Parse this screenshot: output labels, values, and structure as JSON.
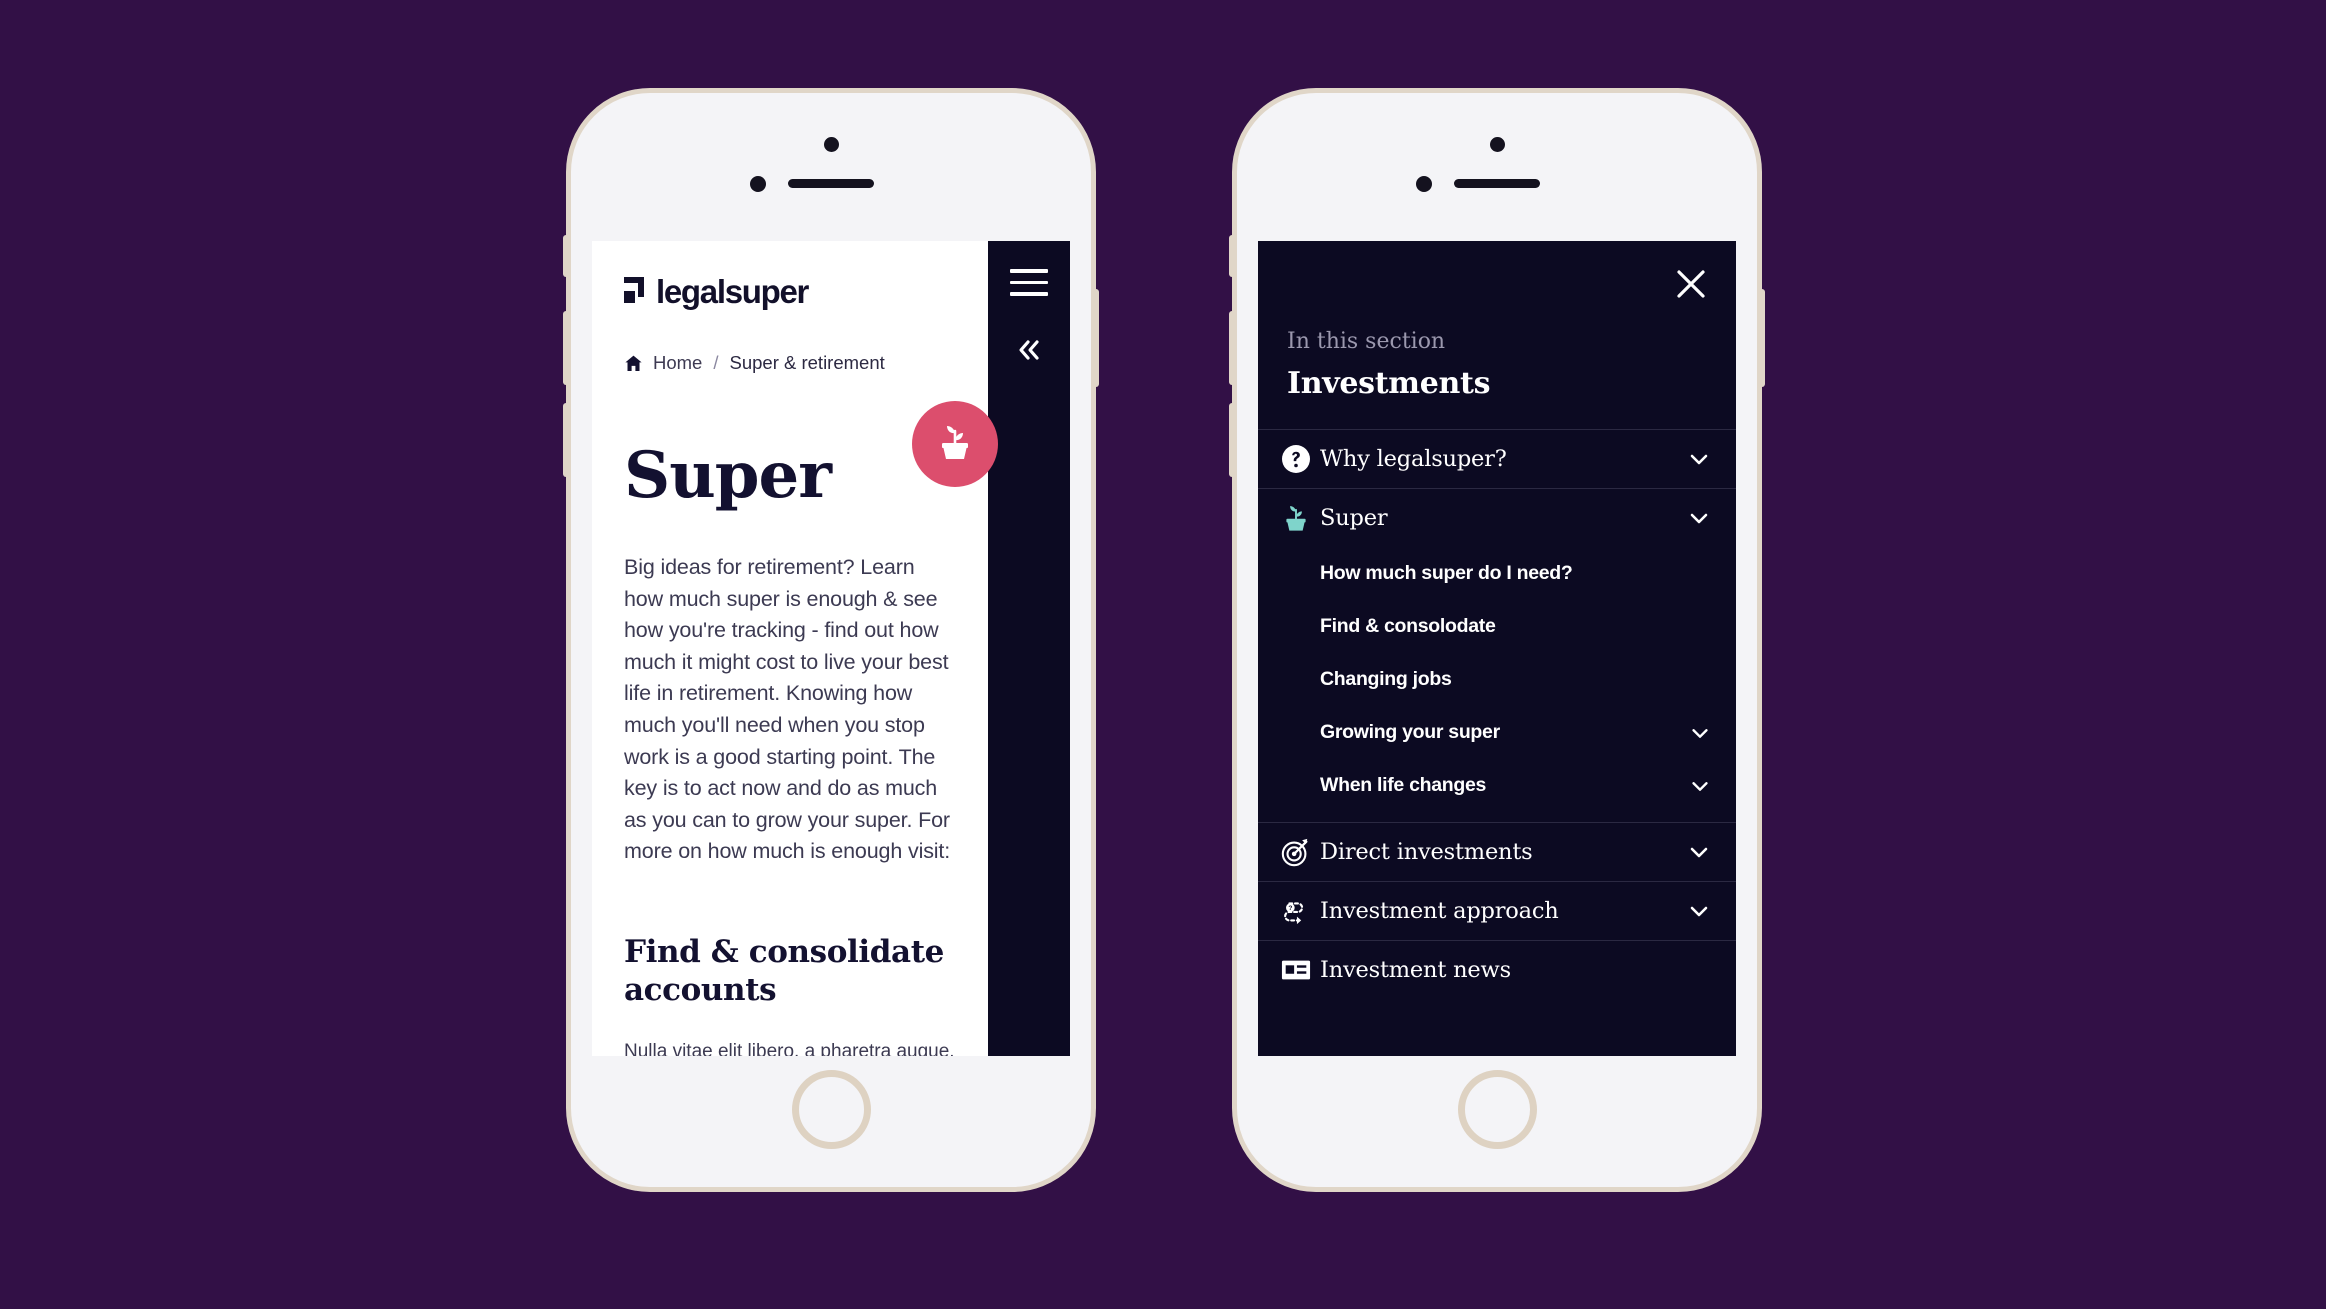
{
  "theme": {
    "background": "#321046",
    "dark_navy": "#0C0A22",
    "accent_pink": "#DC4E6D",
    "accent_teal": "#7FD4CB",
    "frame_beige": "#E0D6C8",
    "screen_white": "#FFFFFF",
    "muted_text": "#9B98AE"
  },
  "brand": {
    "logo_text": "legalsuper",
    "logo_icon": "legalsuper-mark-icon"
  },
  "breadcrumb": {
    "home_icon": "home-icon",
    "home_label": "Home",
    "separator": "/",
    "current_label": "Super & retirement"
  },
  "rail": {
    "menu_icon": "hamburger-menu-icon",
    "collapse_icon": "double-chevron-left-icon"
  },
  "badge": {
    "icon": "potted-plant-icon"
  },
  "article": {
    "title": "Super",
    "lead": "Big ideas for retirement? Learn how much super is enough & see how you're tracking - find out how much it might cost to live your best life in retirement. Knowing how much you'll need when you stop work is a good starting point. The key is to act now and do as much as you can to grow your super. For more on how much is enough visit:",
    "section_heading": "Find & consolidate accounts",
    "section_body": "Nulla vitae elit libero, a pharetra augue."
  },
  "nav_panel": {
    "close_icon": "close-icon",
    "eyebrow": "In this section",
    "heading": "Investments",
    "chevron_icon": "chevron-down-icon",
    "items": [
      {
        "label": "Why legalsuper?",
        "icon": "question-circle-icon",
        "expandable": true,
        "children": []
      },
      {
        "label": "Super",
        "icon": "potted-plant-icon",
        "expandable": true,
        "children": [
          {
            "label": "How much super do I need?",
            "expandable": false
          },
          {
            "label": "Find & consolodate",
            "expandable": false
          },
          {
            "label": "Changing jobs",
            "expandable": false
          },
          {
            "label": "Growing your super",
            "expandable": true
          },
          {
            "label": "When life changes",
            "expandable": true
          }
        ]
      },
      {
        "label": "Direct investments",
        "icon": "target-arrow-icon",
        "expandable": true,
        "children": []
      },
      {
        "label": "Investment approach",
        "icon": "process-question-icon",
        "expandable": true,
        "children": []
      },
      {
        "label": "Investment news",
        "icon": "news-article-icon",
        "expandable": false,
        "children": []
      }
    ]
  }
}
